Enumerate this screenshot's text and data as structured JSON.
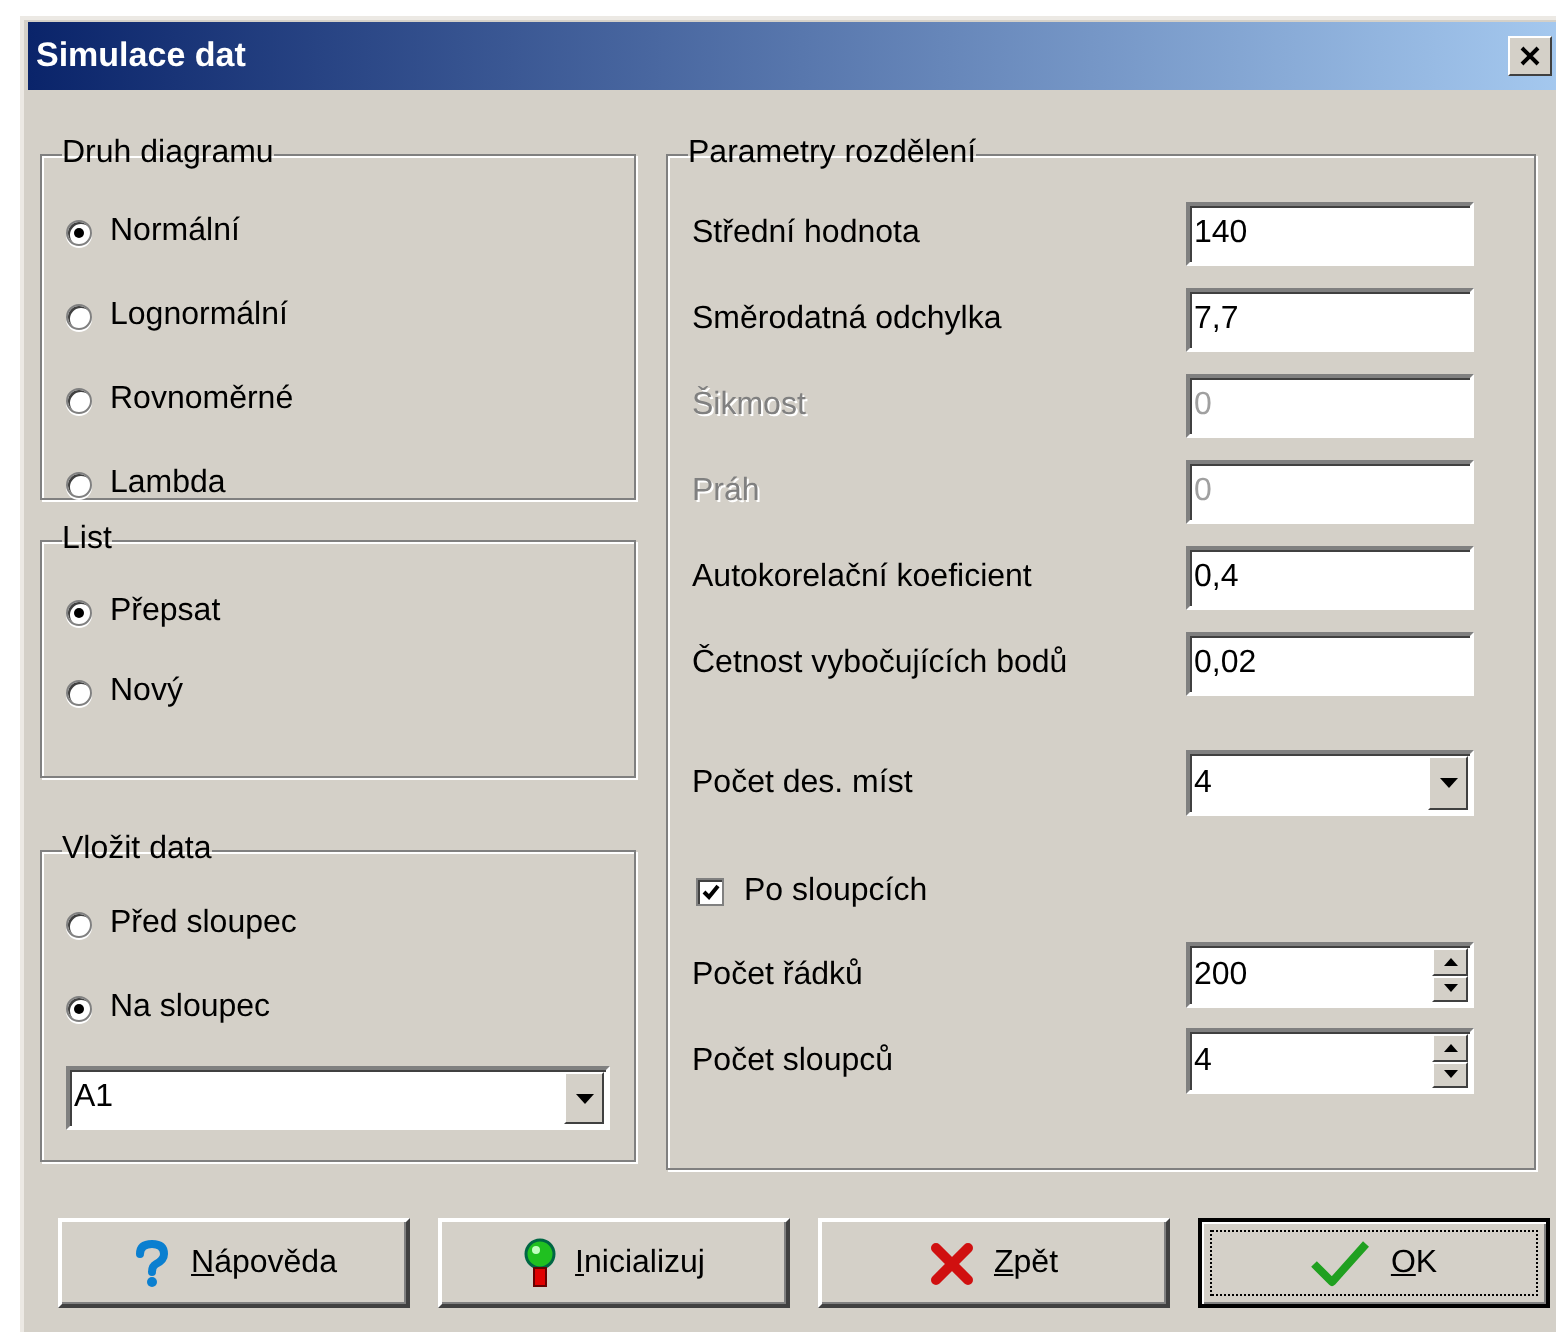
{
  "window": {
    "title": "Simulace dat"
  },
  "diagram_type": {
    "title": "Druh diagramu",
    "options": [
      {
        "label": "Normální",
        "selected": true
      },
      {
        "label": "Lognormální",
        "selected": false
      },
      {
        "label": "Rovnoměrné",
        "selected": false
      },
      {
        "label": "Lambda",
        "selected": false
      }
    ]
  },
  "sheet": {
    "title": "List",
    "options": [
      {
        "label": "Přepsat",
        "selected": true
      },
      {
        "label": "Nový",
        "selected": false
      }
    ]
  },
  "insert_data": {
    "title": "Vložit data",
    "options": [
      {
        "label": "Před sloupec",
        "selected": false
      },
      {
        "label": "Na sloupec",
        "selected": true
      }
    ],
    "dropdown": {
      "value": "A1"
    }
  },
  "parameters": {
    "title": "Parametry rozdělení",
    "fields": [
      {
        "label": "Střední hodnota",
        "value": "140",
        "disabled": false
      },
      {
        "label": "Směrodatná odchylka",
        "value": "7,7",
        "disabled": false
      },
      {
        "label": "Šikmost",
        "value": "0",
        "disabled": true
      },
      {
        "label": "Práh",
        "value": "0",
        "disabled": true
      },
      {
        "label": "Autokorelační koeficient",
        "value": "0,4",
        "disabled": false
      },
      {
        "label": "Četnost vybočujících bodů",
        "value": "0,02",
        "disabled": false
      }
    ],
    "decimals": {
      "label": "Počet des. míst",
      "value": "4"
    },
    "by_columns": {
      "label": "Po sloupcích",
      "checked": true
    },
    "spinners": [
      {
        "label": "Počet řádků",
        "value": "200"
      },
      {
        "label": "Počet sloupců",
        "value": "4"
      }
    ]
  },
  "buttons": [
    {
      "label": "Nápověda",
      "kind": "help",
      "default": false
    },
    {
      "label": "Inicializuj",
      "kind": "init",
      "default": false
    },
    {
      "label": "Zpět",
      "kind": "back",
      "default": false
    },
    {
      "label": "OK",
      "kind": "ok",
      "default": true
    }
  ]
}
